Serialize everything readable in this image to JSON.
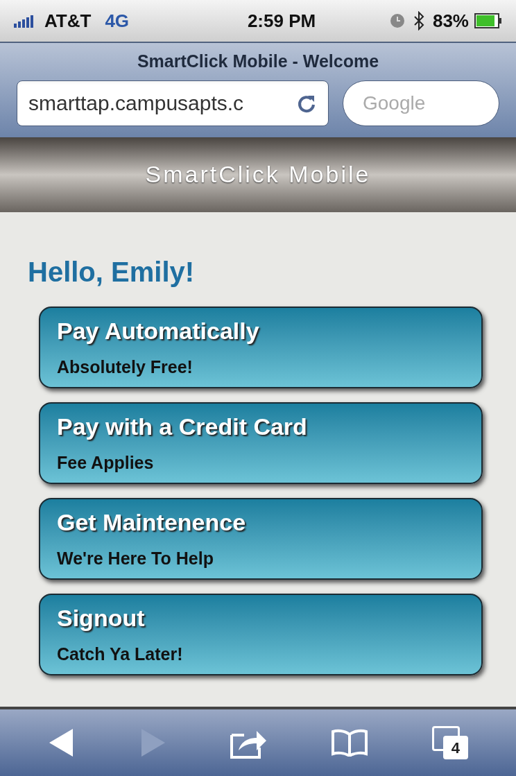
{
  "status_bar": {
    "carrier": "AT&T",
    "network": "4G",
    "time": "2:59 PM",
    "battery": "83%"
  },
  "browser": {
    "title": "SmartClick Mobile - Welcome",
    "url": "smarttap.campusapts.c",
    "search": {
      "placeholder": "Google"
    }
  },
  "header": {
    "title": "SmartClick Mobile"
  },
  "greeting": "Hello, Emily!",
  "menu": [
    {
      "title": "Pay Automatically",
      "subtitle": "Absolutely Free!"
    },
    {
      "title": "Pay with a Credit Card",
      "subtitle": "Fee Applies"
    },
    {
      "title": "Get Maintenence",
      "subtitle": "We're Here To Help"
    },
    {
      "title": "Signout",
      "subtitle": "Catch Ya Later!"
    }
  ],
  "toolbar": {
    "back": {
      "disabled": false
    },
    "forward": {
      "disabled": true
    },
    "tab_count": "4"
  }
}
